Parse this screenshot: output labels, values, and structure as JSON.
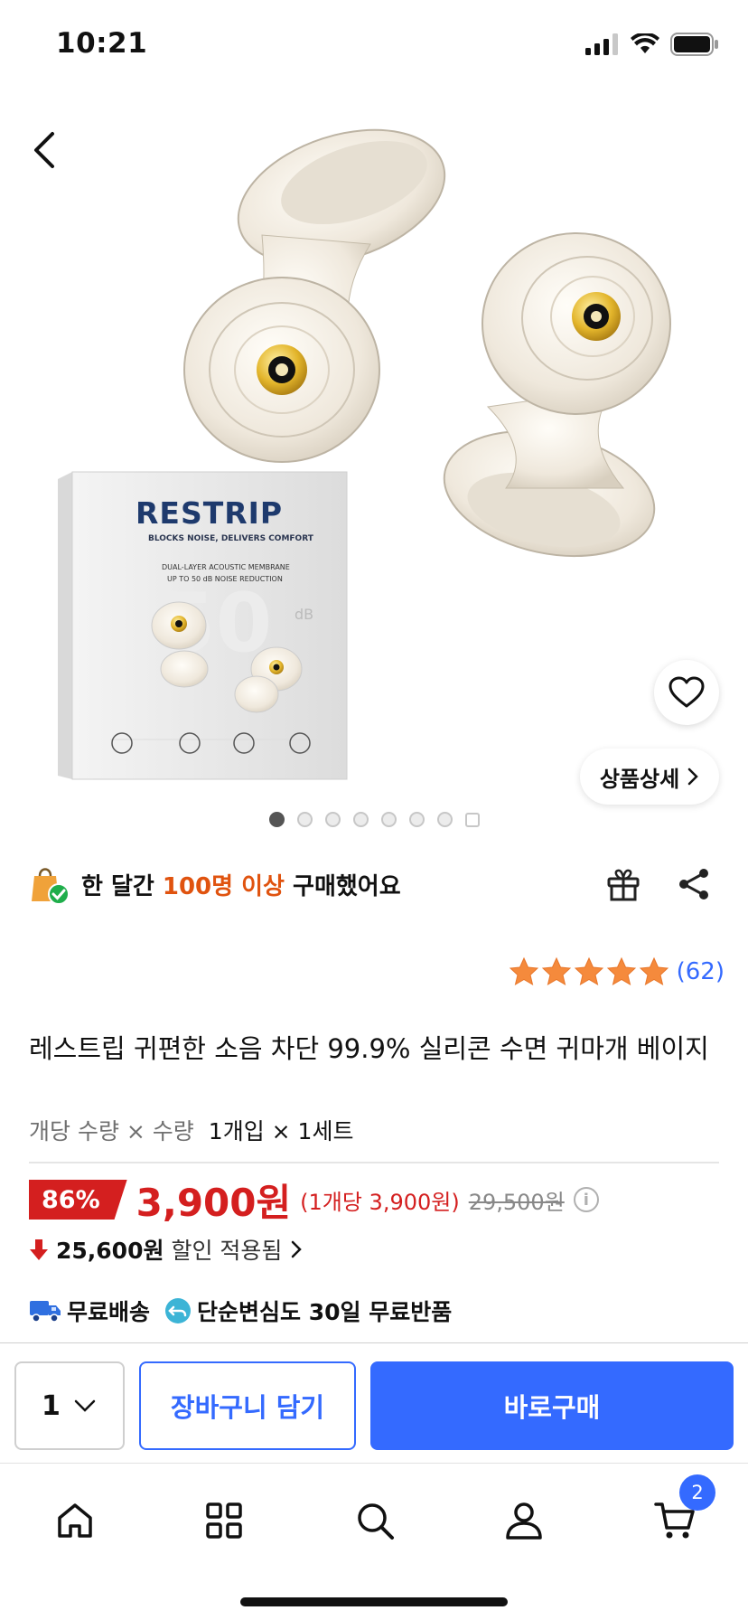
{
  "status_bar": {
    "time": "10:21"
  },
  "hero": {
    "box_brand": "RESTRIP",
    "box_tagline": "BLOCKS NOISE, DELIVERS COMFORT",
    "box_line1": "DUAL-LAYER ACOUSTIC MEMBRANE",
    "box_line2": "UP TO 50 dB NOISE REDUCTION",
    "box_big_number": "50",
    "box_db": "dB",
    "detail_label": "상품상세",
    "image_count": 8,
    "active_image_index": 0
  },
  "purchase_info": {
    "prefix": "한 달간 ",
    "highlight": "100명 이상",
    "suffix": " 구매했어요"
  },
  "rating": {
    "stars": 5,
    "count": "(62)"
  },
  "product": {
    "title": "레스트립 귀편한 소음 차단 99.9% 실리콘 수면 귀마개 베이지",
    "option_label": "개당 수량 × 수량",
    "option_value": "1개입 × 1세트"
  },
  "price": {
    "discount_rate": "86%",
    "sale_price": "3,900원",
    "unit_price": "(1개당 3,900원)",
    "original_price": "29,500원",
    "info_icon_label": "i",
    "discount_amount": "25,600원",
    "discount_text": "할인 적용됨"
  },
  "shipping": {
    "free_shipping": "무료배송",
    "return_policy": "단순변심도 30일 무료반품"
  },
  "action_bar": {
    "quantity": "1",
    "cart_label": "장바구니 담기",
    "buy_label": "바로구매"
  },
  "tab_bar": {
    "cart_badge": "2"
  },
  "colors": {
    "accent_blue": "#346aff",
    "price_red": "#d41f1f",
    "highlight_orange": "#e0530f",
    "star_orange": "#f58a3c"
  }
}
